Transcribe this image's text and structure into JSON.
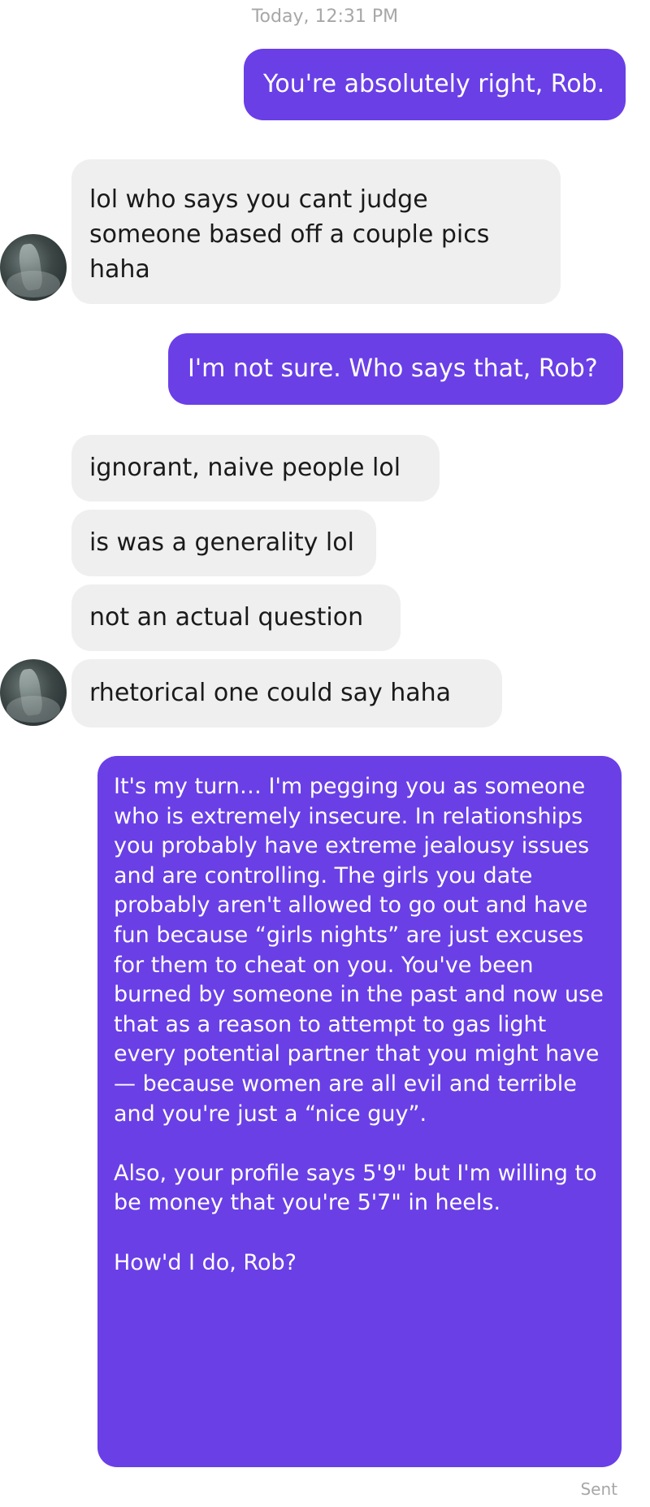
{
  "conversation": {
    "timestamp": "Today, 12:31 PM",
    "status": "Sent",
    "messages": [
      {
        "side": "out",
        "text": "You're absolutely right, Rob."
      },
      {
        "side": "in",
        "text": "lol who says you cant judge someone based off a couple pics haha"
      },
      {
        "side": "out",
        "text": "I'm not sure. Who says that, Rob?"
      },
      {
        "side": "in",
        "text": "ignorant, naive people lol"
      },
      {
        "side": "in",
        "text": "is was a generality lol"
      },
      {
        "side": "in",
        "text": "not an actual question"
      },
      {
        "side": "in",
        "text": "rhetorical one could say haha"
      },
      {
        "side": "out",
        "text": "It's my turn… I'm pegging you as someone who is extremely insecure. In relationships you probably have extreme jealousy issues and are controlling. The girls you date probably aren't allowed to go out and have fun because “girls nights” are just excuses for them to cheat on you. You've been burned by someone in the past and now use that as a reason to attempt to gas light every potential partner that you might have— because women are all evil and terrible and you're just a “nice guy”.\n\nAlso, your profile says 5'9\" but I'm willing to be money that you're 5'7\" in heels.\n\nHow'd I do, Rob?"
      }
    ]
  },
  "colors": {
    "outgoing_bubble": "#6a3fe6",
    "incoming_bubble": "#efefef",
    "meta_text": "#a7a7a7"
  },
  "icons": {
    "contact_avatar": "avatar-icon"
  }
}
